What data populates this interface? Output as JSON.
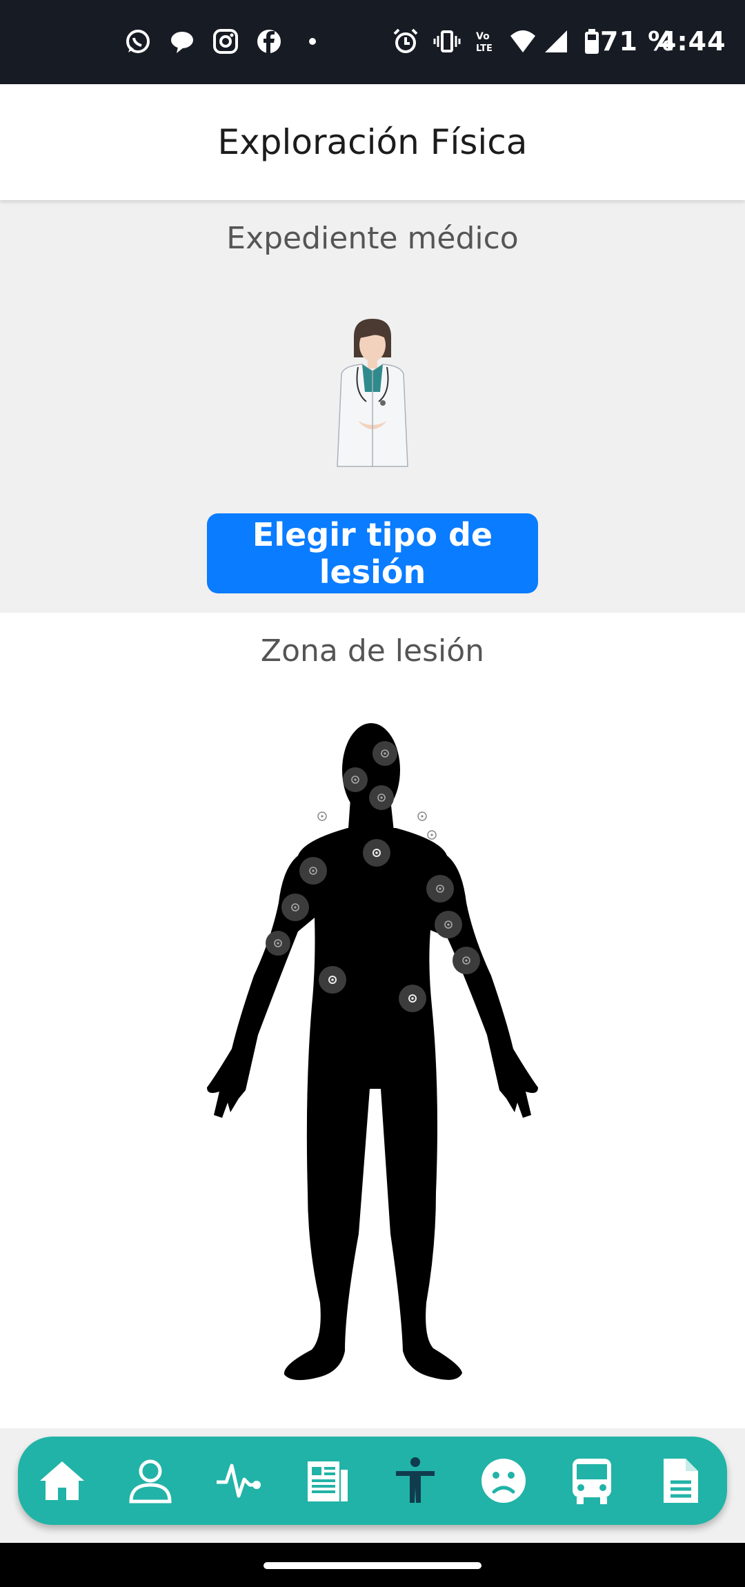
{
  "status_bar": {
    "battery": "71 %",
    "time": "4:44",
    "left_icons": [
      "whatsapp-icon",
      "chat-icon",
      "instagram-icon",
      "facebook-icon",
      "dot-icon"
    ],
    "right_icons": [
      "alarm-icon",
      "vibrate-icon",
      "volte-icon",
      "wifi-icon",
      "signal-icon",
      "battery-icon"
    ]
  },
  "header": {
    "title": "Exploración Física"
  },
  "record": {
    "title": "Expediente médico",
    "button_label": "Elegir tipo de lesión"
  },
  "zone": {
    "title": "Zona de lesión"
  },
  "bottom_nav": {
    "items": [
      "home-icon",
      "profile-icon",
      "vitals-icon",
      "news-icon",
      "body-icon",
      "sad-face-icon",
      "bus-icon",
      "document-icon"
    ],
    "active": "body-icon"
  },
  "colors": {
    "accent": "#0a7cff",
    "nav": "#21b3a7",
    "active_icon": "#103c4e"
  }
}
